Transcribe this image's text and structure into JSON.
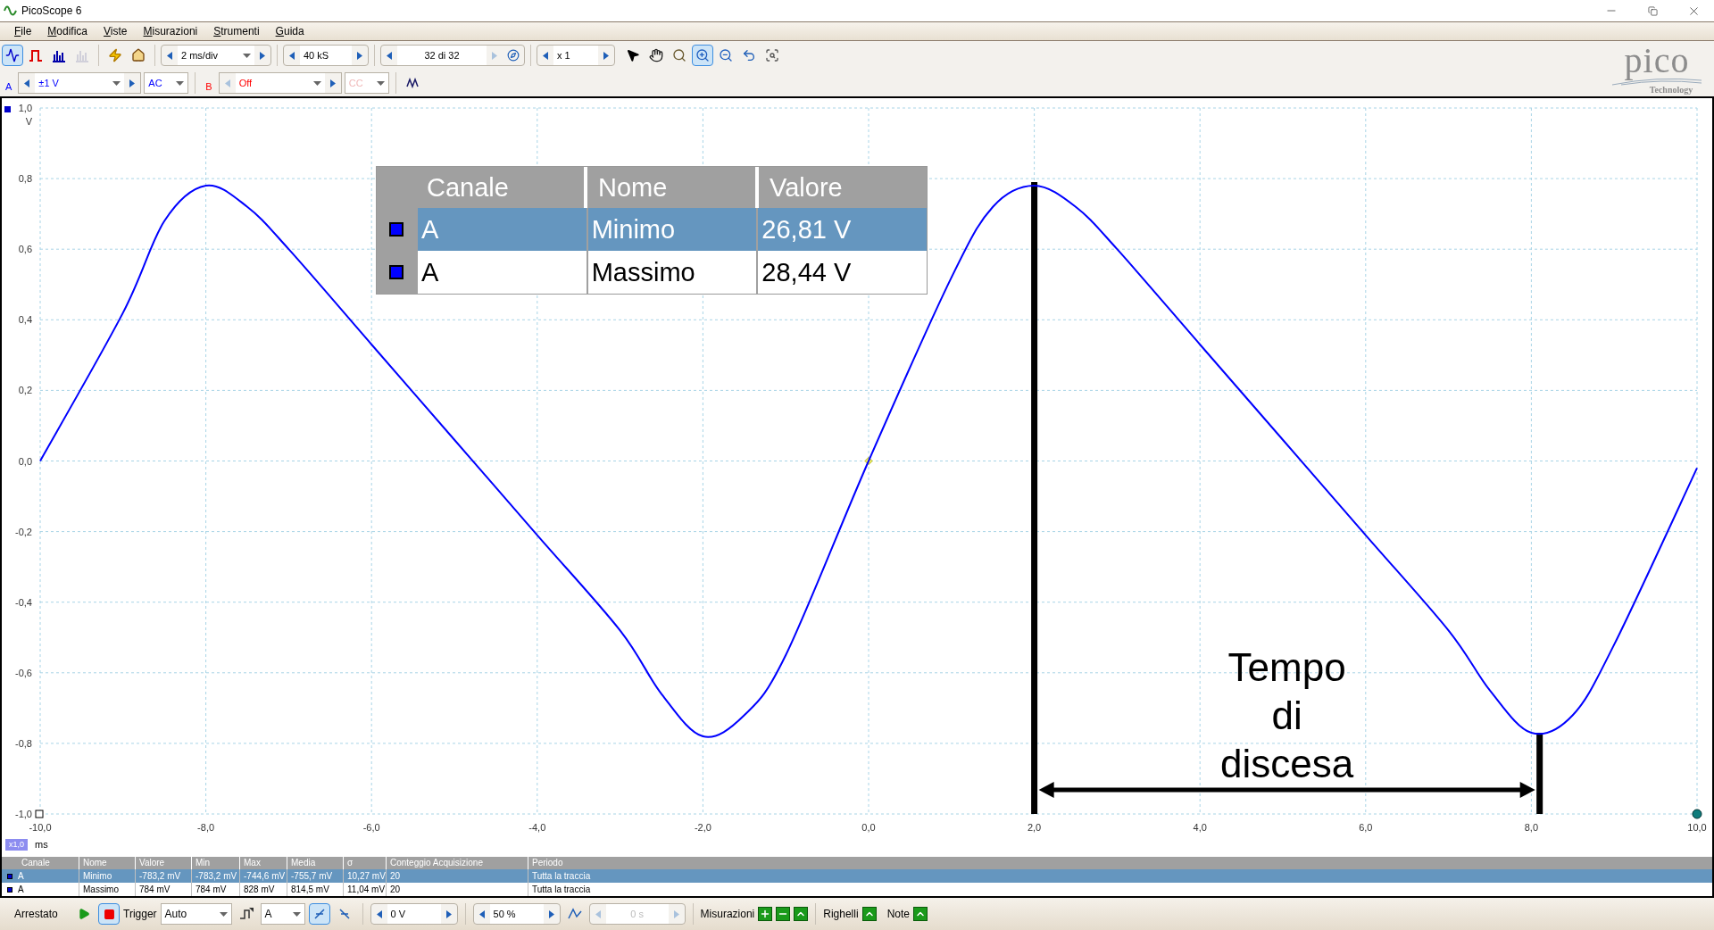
{
  "window": {
    "title": "PicoScope 6"
  },
  "menu": [
    "File",
    "Modifica",
    "Viste",
    "Misurazioni",
    "Strumenti",
    "Guida"
  ],
  "toolbar": {
    "view_buttons": [
      {
        "kind": "scope",
        "selected": true,
        "disabled": false
      },
      {
        "kind": "persistence",
        "selected": false,
        "disabled": false
      },
      {
        "kind": "spectrum",
        "selected": false,
        "disabled": false
      },
      {
        "kind": "spectrum",
        "selected": false,
        "disabled": true
      }
    ],
    "action_buttons": [
      {
        "kind": "auto-setup"
      },
      {
        "kind": "home"
      }
    ],
    "timebase": "2 ms/div",
    "samples": "40 kS",
    "buffer": "32 di 32",
    "zoom_factor": "x 1",
    "tools": [
      {
        "kind": "pointer",
        "selected": false
      },
      {
        "kind": "hand",
        "selected": false
      },
      {
        "kind": "zoom",
        "selected": false
      },
      {
        "kind": "zoom-in",
        "selected": true
      },
      {
        "kind": "zoom-out",
        "selected": false
      },
      {
        "kind": "undo",
        "selected": false
      },
      {
        "kind": "zoom-fit",
        "selected": false
      }
    ]
  },
  "logo": {
    "name": "pico",
    "tagline": "Technology"
  },
  "channels": [
    {
      "label": "A",
      "color": "#0000ff",
      "range": "±1 V",
      "coupling": "AC",
      "coupling_disabled": false
    },
    {
      "label": "B",
      "color": "#ff0000",
      "range": "Off",
      "coupling": "CC",
      "coupling_disabled": true
    }
  ],
  "plot": {
    "y_unit": "V",
    "x_unit": "ms",
    "zoom_badge": "x1,0",
    "chart_data": {
      "type": "line",
      "x": [
        -10,
        -9,
        -8.5,
        -8,
        -7.5,
        -7,
        -6,
        -5,
        -4,
        -3,
        -2.5,
        -2,
        -1.5,
        -1,
        0,
        1,
        1.5,
        2,
        2.5,
        3,
        4,
        5,
        6,
        7,
        7.5,
        8,
        8.5,
        9,
        10
      ],
      "series": [
        {
          "color": "#0000ff",
          "values": [
            0,
            0.42,
            0.68,
            0.78,
            0.72,
            0.6,
            0.33,
            0.06,
            -0.21,
            -0.48,
            -0.66,
            -0.78,
            -0.72,
            -0.55,
            0,
            0.52,
            0.72,
            0.78,
            0.72,
            0.6,
            0.33,
            0.06,
            -0.21,
            -0.48,
            -0.65,
            -0.77,
            -0.72,
            -0.52,
            -0.02
          ]
        }
      ],
      "xlim": [
        -10,
        10
      ],
      "ylim": [
        -1,
        1
      ],
      "xticks": [
        {
          "value": -10,
          "label": "-10,0"
        },
        {
          "value": -8,
          "label": "-8,0"
        },
        {
          "value": -6,
          "label": "-6,0"
        },
        {
          "value": -4,
          "label": "-4,0"
        },
        {
          "value": -2,
          "label": "-2,0"
        },
        {
          "value": 0,
          "label": "0,0"
        },
        {
          "value": 2,
          "label": "2,0"
        },
        {
          "value": 4,
          "label": "4,0"
        },
        {
          "value": 6,
          "label": "6,0"
        },
        {
          "value": 8,
          "label": "8,0"
        },
        {
          "value": 10,
          "label": "10,0"
        }
      ],
      "yticks": [
        {
          "value": 1,
          "label": "1,0"
        },
        {
          "value": 0.8,
          "label": "0,8"
        },
        {
          "value": 0.6,
          "label": "0,6"
        },
        {
          "value": 0.4,
          "label": "0,4"
        },
        {
          "value": 0.2,
          "label": "0,2"
        },
        {
          "value": 0,
          "label": "0,0"
        },
        {
          "value": -0.2,
          "label": "-0,2"
        },
        {
          "value": -0.4,
          "label": "-0,4"
        },
        {
          "value": -0.6,
          "label": "-0,6"
        },
        {
          "value": -0.8,
          "label": "-0,8"
        },
        {
          "value": -1,
          "label": "-1,0"
        }
      ],
      "grid": true,
      "annotations": [
        {
          "text": "Tempo di discesa"
        }
      ]
    },
    "overlay_table": {
      "columns": [
        "Canale",
        "Nome",
        "Valore"
      ],
      "rows": [
        {
          "selected": true,
          "cells": [
            "A",
            "Minimo",
            "26,81 V"
          ]
        },
        {
          "selected": false,
          "cells": [
            "A",
            "Massimo",
            "28,44 V"
          ]
        }
      ]
    }
  },
  "measurements": {
    "columns": [
      "Canale",
      "Nome",
      "Valore",
      "Min",
      "Max",
      "Media",
      "σ",
      "Conteggio Acquisizione",
      "Periodo"
    ],
    "rows": [
      {
        "selected": true,
        "cells": [
          "A",
          "Minimo",
          "-783,2 mV",
          "-783,2 mV",
          "-744,6 mV",
          "-755,7 mV",
          "10,27 mV",
          "20",
          "Tutta la traccia"
        ]
      },
      {
        "selected": false,
        "cells": [
          "A",
          "Massimo",
          "784 mV",
          "784 mV",
          "828 mV",
          "814,5 mV",
          "11,04 mV",
          "20",
          "Tutta la traccia"
        ]
      }
    ]
  },
  "status_bar": {
    "state": "Arrestato",
    "running": false,
    "trigger_label": "Trigger",
    "trigger_mode": "Auto",
    "trigger_source": "A",
    "edges": [
      {
        "kind": "rising",
        "selected": true
      },
      {
        "kind": "falling",
        "selected": false
      }
    ],
    "threshold": "0 V",
    "pre_trigger": "50 %",
    "delay": "0 s",
    "measurements_label": "Misurazioni",
    "rulers_label": "Righelli",
    "notes_label": "Note"
  }
}
